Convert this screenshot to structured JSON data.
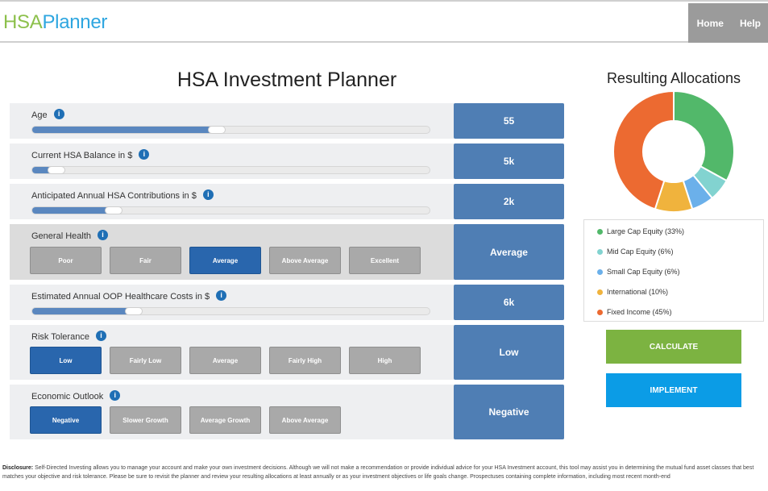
{
  "header": {
    "logo_part1": "HSA",
    "logo_part2": "Planner",
    "nav": [
      "Home",
      "Help"
    ]
  },
  "planner": {
    "title": "HSA Investment Planner",
    "info_icon": "i",
    "age": {
      "label": "Age",
      "value": "55",
      "slider_fraction": 0.465
    },
    "balance": {
      "label": "Current HSA Balance in $",
      "value": "5k",
      "slider_fraction": 0.06
    },
    "contributions": {
      "label": "Anticipated Annual HSA Contributions in $",
      "value": "2k",
      "slider_fraction": 0.205
    },
    "health": {
      "label": "General Health",
      "value": "Average",
      "options": [
        "Poor",
        "Fair",
        "Average",
        "Above Average",
        "Excellent"
      ],
      "selected": "Average"
    },
    "oop": {
      "label": "Estimated Annual OOP Healthcare Costs in $",
      "value": "6k",
      "slider_fraction": 0.255
    },
    "risk": {
      "label": "Risk Tolerance",
      "value": "Low",
      "options": [
        "Low",
        "Fairly Low",
        "Average",
        "Fairly High",
        "High"
      ],
      "selected": "Low"
    },
    "outlook": {
      "label": "Economic Outlook",
      "value": "Negative",
      "options": [
        "Negative",
        "Slower Growth",
        "Average Growth",
        "Above Average"
      ],
      "selected": "Negative"
    }
  },
  "allocations": {
    "title": "Resulting Allocations",
    "items": [
      {
        "label": "Large Cap Equity (33%)",
        "pct": 33,
        "color": "#52b86a"
      },
      {
        "label": "Mid Cap Equity (6%)",
        "pct": 6,
        "color": "#82d3d0"
      },
      {
        "label": "Small Cap Equity (6%)",
        "pct": 6,
        "color": "#6bb0ea"
      },
      {
        "label": "International (10%)",
        "pct": 10,
        "color": "#f0b33d"
      },
      {
        "label": "Fixed Income (45%)",
        "pct": 45,
        "color": "#ec6a31"
      }
    ]
  },
  "buttons": {
    "calculate": "CALCULATE",
    "implement": "IMPLEMENT"
  },
  "disclosure": {
    "lead": "Disclosure:",
    "text": "Self-Directed Investing allows you to manage your account and make your own investment decisions. Although we will not make a recommendation or provide individual advice for your HSA Investment account, this tool may assist you in determining the mutual fund asset classes that best matches your objective and risk tolerance. Please be sure to revisit the planner and review your resulting allocations at least annually or as your investment objectives or life goals change. Prospectuses containing complete information, including most recent month-end"
  }
}
